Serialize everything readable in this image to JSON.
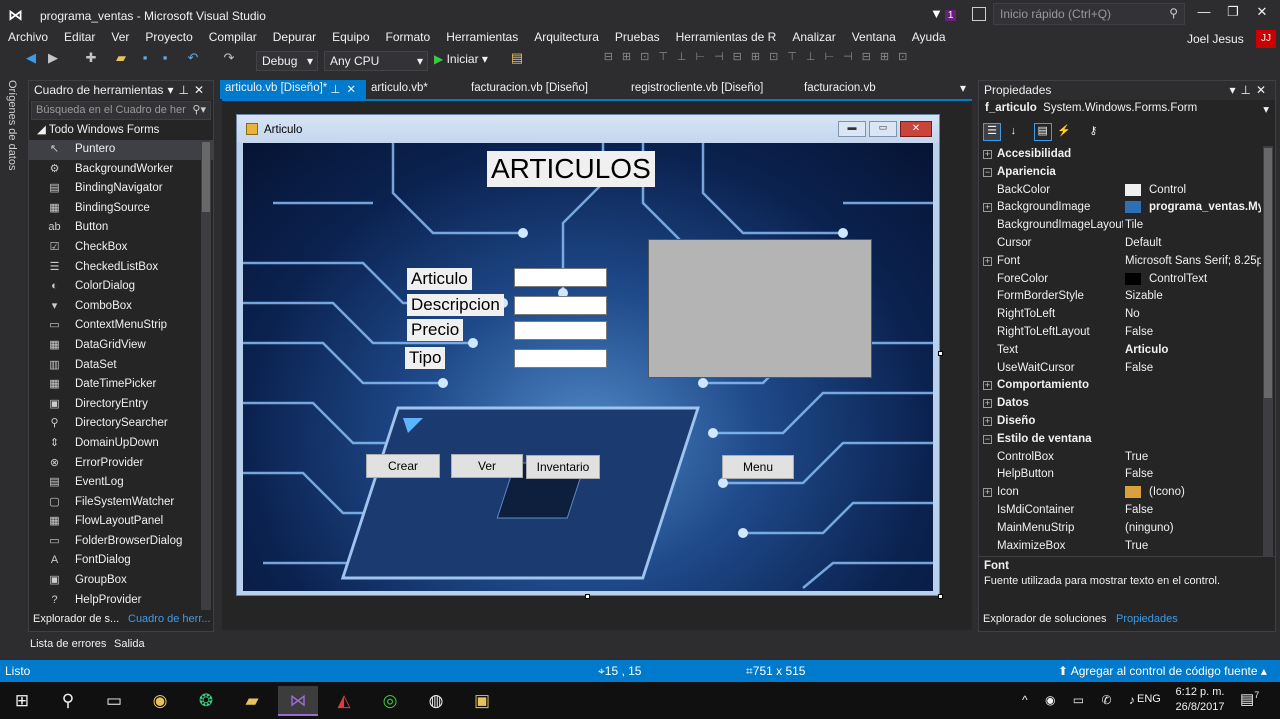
{
  "titlebar": {
    "title": "programa_ventas - Microsoft Visual Studio",
    "notif_count": "1",
    "quick_launch": "Inicio rápido (Ctrl+Q)"
  },
  "menu": [
    "Archivo",
    "Editar",
    "Ver",
    "Proyecto",
    "Compilar",
    "Depurar",
    "Equipo",
    "Formato",
    "Herramientas",
    "Arquitectura",
    "Pruebas",
    "Herramientas de R",
    "Analizar",
    "Ventana",
    "Ayuda"
  ],
  "user": {
    "name": "Joel Jesus",
    "initials": "JJ"
  },
  "toolbar": {
    "config": "Debug",
    "platform": "Any CPU",
    "start_label": "Iniciar"
  },
  "left_strip": {
    "label": "Orígenes de datos"
  },
  "toolbox": {
    "title": "Cuadro de herramientas",
    "search_placeholder": "Búsqueda en el Cuadro de her",
    "group": "Todo Windows Forms",
    "items": [
      {
        "label": "Puntero",
        "icon": "↖"
      },
      {
        "label": "BackgroundWorker",
        "icon": "⚙"
      },
      {
        "label": "BindingNavigator",
        "icon": "▤"
      },
      {
        "label": "BindingSource",
        "icon": "▦"
      },
      {
        "label": "Button",
        "icon": "ab"
      },
      {
        "label": "CheckBox",
        "icon": "☑"
      },
      {
        "label": "CheckedListBox",
        "icon": "☰"
      },
      {
        "label": "ColorDialog",
        "icon": "◐"
      },
      {
        "label": "ComboBox",
        "icon": "▾"
      },
      {
        "label": "ContextMenuStrip",
        "icon": "▭"
      },
      {
        "label": "DataGridView",
        "icon": "▦"
      },
      {
        "label": "DataSet",
        "icon": "▥"
      },
      {
        "label": "DateTimePicker",
        "icon": "▦"
      },
      {
        "label": "DirectoryEntry",
        "icon": "▣"
      },
      {
        "label": "DirectorySearcher",
        "icon": "⚲"
      },
      {
        "label": "DomainUpDown",
        "icon": "⇕"
      },
      {
        "label": "ErrorProvider",
        "icon": "⊗"
      },
      {
        "label": "EventLog",
        "icon": "▤"
      },
      {
        "label": "FileSystemWatcher",
        "icon": "▢"
      },
      {
        "label": "FlowLayoutPanel",
        "icon": "▦"
      },
      {
        "label": "FolderBrowserDialog",
        "icon": "▭"
      },
      {
        "label": "FontDialog",
        "icon": "A"
      },
      {
        "label": "GroupBox",
        "icon": "▣"
      },
      {
        "label": "HelpProvider",
        "icon": "?"
      }
    ],
    "bottom_tabs": [
      "Explorador de s...",
      "Cuadro de herr..."
    ]
  },
  "output_tabs": [
    "Lista de errores",
    "Salida"
  ],
  "doc_tabs": [
    "articulo.vb [Diseño]*",
    "articulo.vb*",
    "facturacion.vb [Diseño]",
    "registrocliente.vb [Diseño]",
    "facturacion.vb"
  ],
  "form": {
    "title": "Articulo",
    "heading": "ARTICULOS",
    "labels": [
      "Articulo",
      "Descripcion",
      "Precio",
      "Tipo"
    ],
    "buttons": [
      "Crear",
      "Ver",
      "Inventario",
      "Menu"
    ]
  },
  "properties": {
    "title": "Propiedades",
    "object": "f_articulo",
    "object_type": "System.Windows.Forms.Form",
    "rows": [
      {
        "name": "Accesibilidad",
        "value": "",
        "cat": true,
        "exp": "+"
      },
      {
        "name": "Apariencia",
        "value": "",
        "cat": true,
        "exp": "−"
      },
      {
        "name": "BackColor",
        "value": "Control",
        "swatch": "#f0f0f0"
      },
      {
        "name": "BackgroundImage",
        "value": "programa_ventas.My",
        "bold": true,
        "exp": "+",
        "swatch": "#2f6fb8"
      },
      {
        "name": "BackgroundImageLayout",
        "value": "Tile"
      },
      {
        "name": "Cursor",
        "value": "Default"
      },
      {
        "name": "Font",
        "value": "Microsoft Sans Serif; 8.25pt",
        "exp": "+"
      },
      {
        "name": "ForeColor",
        "value": "ControlText",
        "swatch": "#000000"
      },
      {
        "name": "FormBorderStyle",
        "value": "Sizable"
      },
      {
        "name": "RightToLeft",
        "value": "No"
      },
      {
        "name": "RightToLeftLayout",
        "value": "False"
      },
      {
        "name": "Text",
        "value": "Articulo",
        "bold": true
      },
      {
        "name": "UseWaitCursor",
        "value": "False"
      },
      {
        "name": "Comportamiento",
        "value": "",
        "cat": true,
        "exp": "+"
      },
      {
        "name": "Datos",
        "value": "",
        "cat": true,
        "exp": "+"
      },
      {
        "name": "Diseño",
        "value": "",
        "cat": true,
        "exp": "+"
      },
      {
        "name": "Estilo de ventana",
        "value": "",
        "cat": true,
        "exp": "−"
      },
      {
        "name": "ControlBox",
        "value": "True"
      },
      {
        "name": "HelpButton",
        "value": "False"
      },
      {
        "name": "Icon",
        "value": "(Icono)",
        "exp": "+",
        "swatch": "#d9a13b"
      },
      {
        "name": "IsMdiContainer",
        "value": "False"
      },
      {
        "name": "MainMenuStrip",
        "value": "(ninguno)"
      },
      {
        "name": "MaximizeBox",
        "value": "True"
      }
    ],
    "desc_title": "Font",
    "desc_text": "Fuente utilizada para mostrar texto en el control.",
    "bottom_tabs": [
      "Explorador de soluciones",
      "Propiedades"
    ]
  },
  "status": {
    "text": "Listo",
    "position": "15 , 15",
    "size": "751 x 515",
    "source_control": "Agregar al control de código fuente"
  },
  "taskbar": {
    "lang": "ENG",
    "time": "6:12 p. m.",
    "date": "26/8/2017",
    "notif": "7"
  },
  "colors": {
    "accent": "#007acc",
    "bg": "#2d2d30",
    "panel": "#252526"
  }
}
